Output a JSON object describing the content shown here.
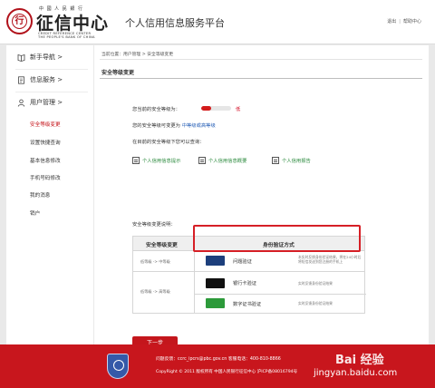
{
  "header": {
    "logo_top": "中 國 人 民 銀 行",
    "logo_main": "征信中心",
    "logo_sub1": "CREDIT REFERENCE CENTER",
    "logo_sub2": "THE PEOPLE'S BANK OF CHINA",
    "title": "个人信用信息服务平台",
    "logout": "退出",
    "sep": "|",
    "help": "帮助中心"
  },
  "sidebar": {
    "groups": [
      {
        "label": "新手导航 >"
      },
      {
        "label": "信息服务 >"
      },
      {
        "label": "用户管理 >"
      }
    ],
    "items": [
      {
        "label": "安全等级变更",
        "active": true
      },
      {
        "label": "设置快捷查询"
      },
      {
        "label": "基本信息修改"
      },
      {
        "label": "手机号码修改"
      },
      {
        "label": "我的消息"
      },
      {
        "label": "销户"
      }
    ]
  },
  "main": {
    "breadcrumb": "当前位置：用户管理 > 安全等级变更",
    "section_title": "安全等级变更",
    "current_level_label": "您当前的安全等级为：",
    "current_level_value": "低",
    "current_level_fraction": 0.33,
    "changeable_prefix": "您的安全等级可变更为",
    "changeable_levels": "中等级或高等级",
    "query_intro": "在目前的安全等级下您可以查询：",
    "query_links": [
      {
        "label": "个人信用信息提示"
      },
      {
        "label": "个人信用信息概要"
      },
      {
        "label": "个人信用报告"
      }
    ],
    "table_intro": "安全等级变更说明：",
    "table": {
      "headers": [
        "安全等级变更",
        "身份验证方式"
      ],
      "rows": [
        {
          "change": "低等级 -> 中等级",
          "method": "问题验证",
          "note": "本实时反馈身份验证结果，将在24小时后将短信发送到您注册的手机上"
        },
        {
          "change": "低等级 -> 高等级",
          "method": "银行卡验证",
          "note": "实时反馈身份验证结果"
        },
        {
          "change": "",
          "method": "数字证书验证",
          "note": "实时反馈身份验证结果"
        }
      ]
    },
    "next_button": "下一步"
  },
  "footer": {
    "line1": "问题反馈：ccrc_ipcrs@pbc.gov.cn    客服电话：400-810-8866",
    "line2": "CopyRight © 2011  版权所有  中国人民银行征信中心  沪ICP备08016794号"
  },
  "watermark": {
    "top": "Bai 经验",
    "bottom": "jingyan.baidu.com"
  },
  "colors": {
    "brand_red": "#c4161c",
    "link_blue": "#2a62b8",
    "link_green": "#2b8a3e",
    "level_low": "#d31b1b"
  }
}
